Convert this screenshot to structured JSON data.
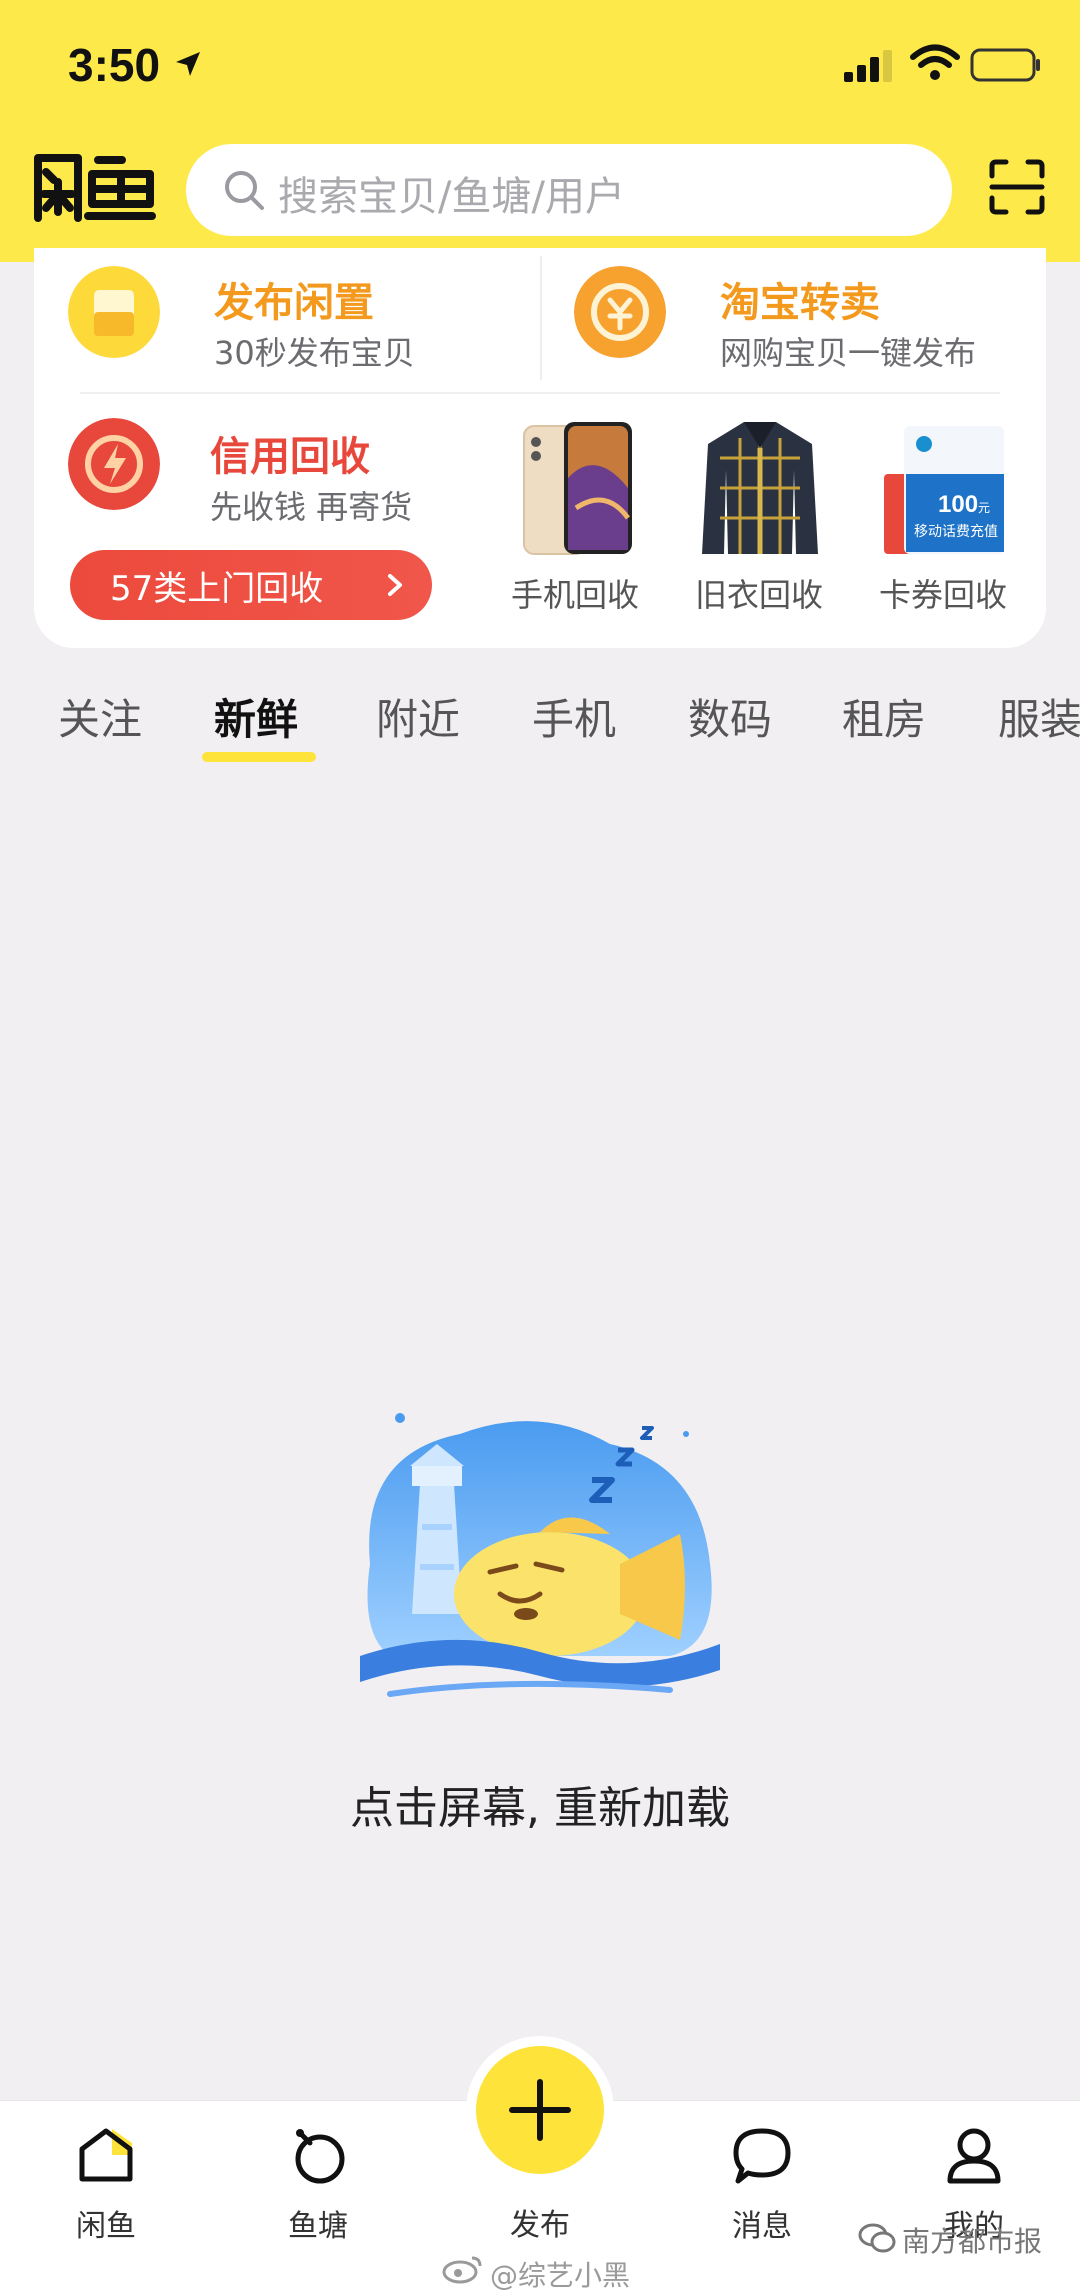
{
  "status_bar": {
    "time": "3:50"
  },
  "header": {
    "logo_text": "闲鱼",
    "search_placeholder": "搜索宝贝/鱼塘/用户"
  },
  "services": {
    "publish_idle": {
      "title": "发布闲置",
      "subtitle": "30秒发布宝贝",
      "color": "#f39a1e"
    },
    "taobao_resell": {
      "title": "淘宝转卖",
      "subtitle": "网购宝贝一键发布",
      "color": "#f39a1e"
    },
    "credit_recycle": {
      "title": "信用回收",
      "subtitle": "先收钱 再寄货",
      "color": "#e8483c"
    },
    "recycle_button": "57类上门回收",
    "recycle_items": [
      {
        "label": "手机回收"
      },
      {
        "label": "旧衣回收"
      },
      {
        "label": "卡券回收"
      }
    ],
    "card_voucher_text": "100",
    "card_voucher_unit": "元",
    "card_voucher_caption": "移动话费充值"
  },
  "tabs": {
    "items": [
      "关注",
      "新鲜",
      "附近",
      "手机",
      "数码",
      "租房",
      "服装"
    ],
    "active": "新鲜"
  },
  "empty_state": {
    "message": "点击屏幕, 重新加载"
  },
  "bottom_nav": {
    "home": "闲鱼",
    "fishpond": "鱼塘",
    "publish": "发布",
    "messages": "消息",
    "mine": "我的"
  },
  "watermarks": {
    "weibo": "@综艺小黑",
    "source": "南方都市报"
  },
  "colors": {
    "brand_yellow": "#fdea4a",
    "accent_red": "#e8483c",
    "accent_orange": "#f39a1e"
  }
}
